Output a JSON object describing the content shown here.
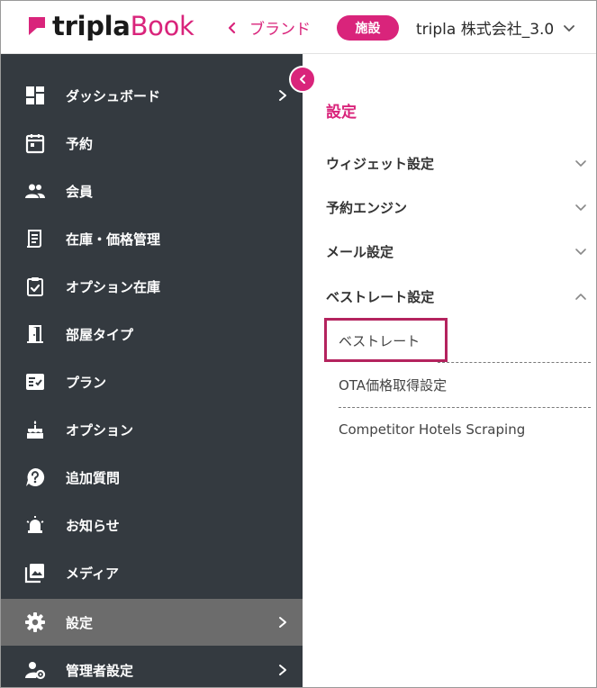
{
  "header": {
    "logo_part1": "tripla",
    "logo_part2": "Book",
    "back_label": "ブランド",
    "facility_badge": "施設",
    "company_name": "tripla 株式会社_3.0",
    "brand_color": "#d9247b"
  },
  "sidebar": {
    "items": [
      {
        "label": "ダッシュボード",
        "icon": "dashboard-icon",
        "arrow": true
      },
      {
        "label": "予約",
        "icon": "calendar-icon",
        "arrow": false
      },
      {
        "label": "会員",
        "icon": "members-icon",
        "arrow": false
      },
      {
        "label": "在庫・価格管理",
        "icon": "inventory-icon",
        "arrow": false
      },
      {
        "label": "オプション在庫",
        "icon": "clipboard-check-icon",
        "arrow": false
      },
      {
        "label": "部屋タイプ",
        "icon": "door-icon",
        "arrow": false
      },
      {
        "label": "プラン",
        "icon": "plan-icon",
        "arrow": false
      },
      {
        "label": "オプション",
        "icon": "cake-icon",
        "arrow": false
      },
      {
        "label": "追加質問",
        "icon": "question-icon",
        "arrow": false
      },
      {
        "label": "お知らせ",
        "icon": "alarm-icon",
        "arrow": false
      },
      {
        "label": "メディア",
        "icon": "media-icon",
        "arrow": false
      },
      {
        "label": "設定",
        "icon": "gear-icon",
        "arrow": true,
        "active": true
      },
      {
        "label": "管理者設定",
        "icon": "admin-settings-icon",
        "arrow": true
      }
    ],
    "bg_color": "#343a40",
    "active_color": "#6c6c6c"
  },
  "settings": {
    "title": "設定",
    "sections": [
      {
        "label": "ウィジェット設定",
        "expanded": false
      },
      {
        "label": "予約エンジン",
        "expanded": false
      },
      {
        "label": "メール設定",
        "expanded": false
      },
      {
        "label": "ベストレート設定",
        "expanded": true
      }
    ],
    "sub_items": [
      {
        "label": "ベストレート",
        "highlighted": true
      },
      {
        "label": "OTA価格取得設定"
      },
      {
        "label": "Competitor Hotels Scraping"
      }
    ]
  }
}
